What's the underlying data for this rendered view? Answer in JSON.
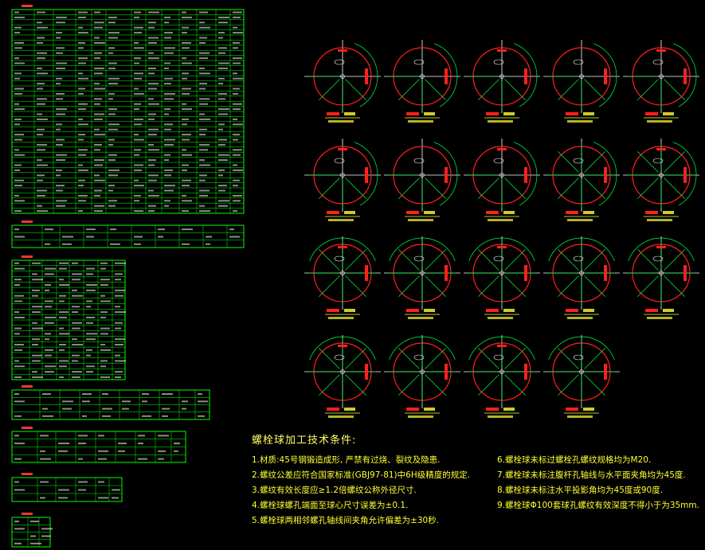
{
  "notes": {
    "title": "螺栓球加工技术条件:",
    "left": [
      "1.材质:45号钢锻造成形, 严禁有过烧、裂纹及隐患.",
      "2.螺纹公差应符合国家标准(GBJ97-81)中6H级精度的规定.",
      "3.螺纹有效长度应≥1.2倍螺纹公称外径尺寸.",
      "4.螺栓球螺孔端面至球心尺寸误差为±0.1.",
      "5.螺栓球两相邻螺孔轴线间夹角允许偏差为±30秒."
    ],
    "right": [
      "6.螺栓球未标过螺栓孔螺纹规格均为M20.",
      "7.螺栓球未标注腹杆孔轴线与水平面夹角均为45度.",
      "8.螺栓球未标注水平投影角均为45度或90度.",
      "9.螺栓球Φ100套球孔螺纹有效深度不得小于为35mm."
    ]
  },
  "colors": {
    "background": "#000000",
    "table_line": "#00ff00",
    "table_text": "#ffffff",
    "header_mark": "#ff3333",
    "circle": "#ff2020",
    "axis": "#ffffff",
    "radial": "#00ff44",
    "label": "#ffff33"
  }
}
